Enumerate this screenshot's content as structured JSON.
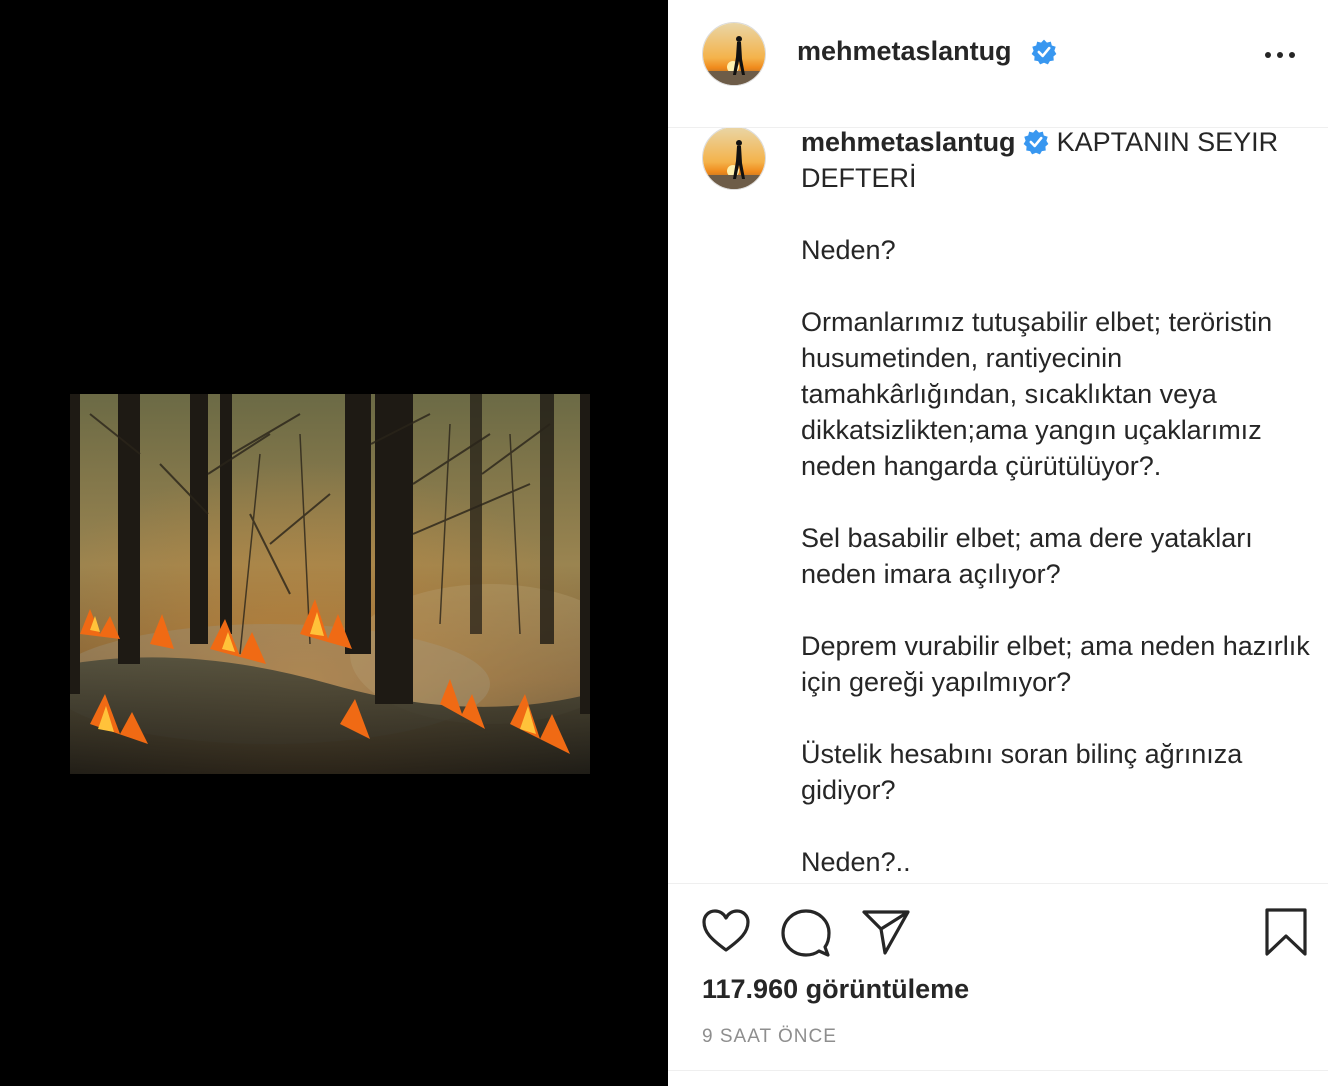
{
  "post": {
    "username": "mehmetaslantug",
    "verified": true,
    "more_options_icon": "ellipsis-icon",
    "caption": {
      "username": "mehmetaslantug",
      "title": "KAPTANIN SEYIR DEFTERİ",
      "paragraphs": [
        "Neden?",
        "Ormanlarımız tutuşabilir elbet; teröristin husumetinden, rantiyecinin tamahkârlığından, sıcaklıktan veya dikkatsizlikten;ama yangın uçaklarımız neden hangarda çürütülüyor?.",
        "Sel basabilir elbet; ama dere yatakları neden imara açılıyor?",
        "Deprem vurabilir elbet; ama neden hazırlık için gereği yapılmıyor?",
        "Üstelik hesabını soran bilinç ağrınıza gidiyor?",
        "Neden?.."
      ]
    },
    "actions": {
      "like_icon": "heart-icon",
      "comment_icon": "comment-icon",
      "share_icon": "paper-plane-icon",
      "save_icon": "bookmark-icon"
    },
    "views": "117.960 görüntüleme",
    "time": "9 SAAT ÖNCE"
  },
  "colors": {
    "verified_blue": "#3897f0",
    "text": "#262626",
    "muted": "#8e8e8e",
    "media_background": "#000000"
  }
}
